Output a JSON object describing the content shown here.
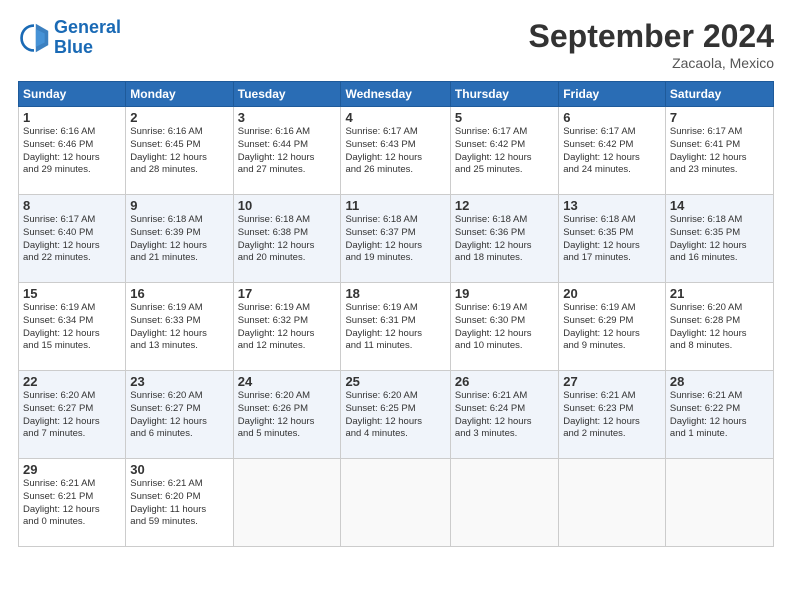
{
  "header": {
    "logo_line1": "General",
    "logo_line2": "Blue",
    "month": "September 2024",
    "location": "Zacaola, Mexico"
  },
  "days_of_week": [
    "Sunday",
    "Monday",
    "Tuesday",
    "Wednesday",
    "Thursday",
    "Friday",
    "Saturday"
  ],
  "weeks": [
    [
      {
        "day": "1",
        "info": "Sunrise: 6:16 AM\nSunset: 6:46 PM\nDaylight: 12 hours\nand 29 minutes."
      },
      {
        "day": "2",
        "info": "Sunrise: 6:16 AM\nSunset: 6:45 PM\nDaylight: 12 hours\nand 28 minutes."
      },
      {
        "day": "3",
        "info": "Sunrise: 6:16 AM\nSunset: 6:44 PM\nDaylight: 12 hours\nand 27 minutes."
      },
      {
        "day": "4",
        "info": "Sunrise: 6:17 AM\nSunset: 6:43 PM\nDaylight: 12 hours\nand 26 minutes."
      },
      {
        "day": "5",
        "info": "Sunrise: 6:17 AM\nSunset: 6:42 PM\nDaylight: 12 hours\nand 25 minutes."
      },
      {
        "day": "6",
        "info": "Sunrise: 6:17 AM\nSunset: 6:42 PM\nDaylight: 12 hours\nand 24 minutes."
      },
      {
        "day": "7",
        "info": "Sunrise: 6:17 AM\nSunset: 6:41 PM\nDaylight: 12 hours\nand 23 minutes."
      }
    ],
    [
      {
        "day": "8",
        "info": "Sunrise: 6:17 AM\nSunset: 6:40 PM\nDaylight: 12 hours\nand 22 minutes."
      },
      {
        "day": "9",
        "info": "Sunrise: 6:18 AM\nSunset: 6:39 PM\nDaylight: 12 hours\nand 21 minutes."
      },
      {
        "day": "10",
        "info": "Sunrise: 6:18 AM\nSunset: 6:38 PM\nDaylight: 12 hours\nand 20 minutes."
      },
      {
        "day": "11",
        "info": "Sunrise: 6:18 AM\nSunset: 6:37 PM\nDaylight: 12 hours\nand 19 minutes."
      },
      {
        "day": "12",
        "info": "Sunrise: 6:18 AM\nSunset: 6:36 PM\nDaylight: 12 hours\nand 18 minutes."
      },
      {
        "day": "13",
        "info": "Sunrise: 6:18 AM\nSunset: 6:35 PM\nDaylight: 12 hours\nand 17 minutes."
      },
      {
        "day": "14",
        "info": "Sunrise: 6:18 AM\nSunset: 6:35 PM\nDaylight: 12 hours\nand 16 minutes."
      }
    ],
    [
      {
        "day": "15",
        "info": "Sunrise: 6:19 AM\nSunset: 6:34 PM\nDaylight: 12 hours\nand 15 minutes."
      },
      {
        "day": "16",
        "info": "Sunrise: 6:19 AM\nSunset: 6:33 PM\nDaylight: 12 hours\nand 13 minutes."
      },
      {
        "day": "17",
        "info": "Sunrise: 6:19 AM\nSunset: 6:32 PM\nDaylight: 12 hours\nand 12 minutes."
      },
      {
        "day": "18",
        "info": "Sunrise: 6:19 AM\nSunset: 6:31 PM\nDaylight: 12 hours\nand 11 minutes."
      },
      {
        "day": "19",
        "info": "Sunrise: 6:19 AM\nSunset: 6:30 PM\nDaylight: 12 hours\nand 10 minutes."
      },
      {
        "day": "20",
        "info": "Sunrise: 6:19 AM\nSunset: 6:29 PM\nDaylight: 12 hours\nand 9 minutes."
      },
      {
        "day": "21",
        "info": "Sunrise: 6:20 AM\nSunset: 6:28 PM\nDaylight: 12 hours\nand 8 minutes."
      }
    ],
    [
      {
        "day": "22",
        "info": "Sunrise: 6:20 AM\nSunset: 6:27 PM\nDaylight: 12 hours\nand 7 minutes."
      },
      {
        "day": "23",
        "info": "Sunrise: 6:20 AM\nSunset: 6:27 PM\nDaylight: 12 hours\nand 6 minutes."
      },
      {
        "day": "24",
        "info": "Sunrise: 6:20 AM\nSunset: 6:26 PM\nDaylight: 12 hours\nand 5 minutes."
      },
      {
        "day": "25",
        "info": "Sunrise: 6:20 AM\nSunset: 6:25 PM\nDaylight: 12 hours\nand 4 minutes."
      },
      {
        "day": "26",
        "info": "Sunrise: 6:21 AM\nSunset: 6:24 PM\nDaylight: 12 hours\nand 3 minutes."
      },
      {
        "day": "27",
        "info": "Sunrise: 6:21 AM\nSunset: 6:23 PM\nDaylight: 12 hours\nand 2 minutes."
      },
      {
        "day": "28",
        "info": "Sunrise: 6:21 AM\nSunset: 6:22 PM\nDaylight: 12 hours\nand 1 minute."
      }
    ],
    [
      {
        "day": "29",
        "info": "Sunrise: 6:21 AM\nSunset: 6:21 PM\nDaylight: 12 hours\nand 0 minutes."
      },
      {
        "day": "30",
        "info": "Sunrise: 6:21 AM\nSunset: 6:20 PM\nDaylight: 11 hours\nand 59 minutes."
      },
      null,
      null,
      null,
      null,
      null
    ]
  ]
}
